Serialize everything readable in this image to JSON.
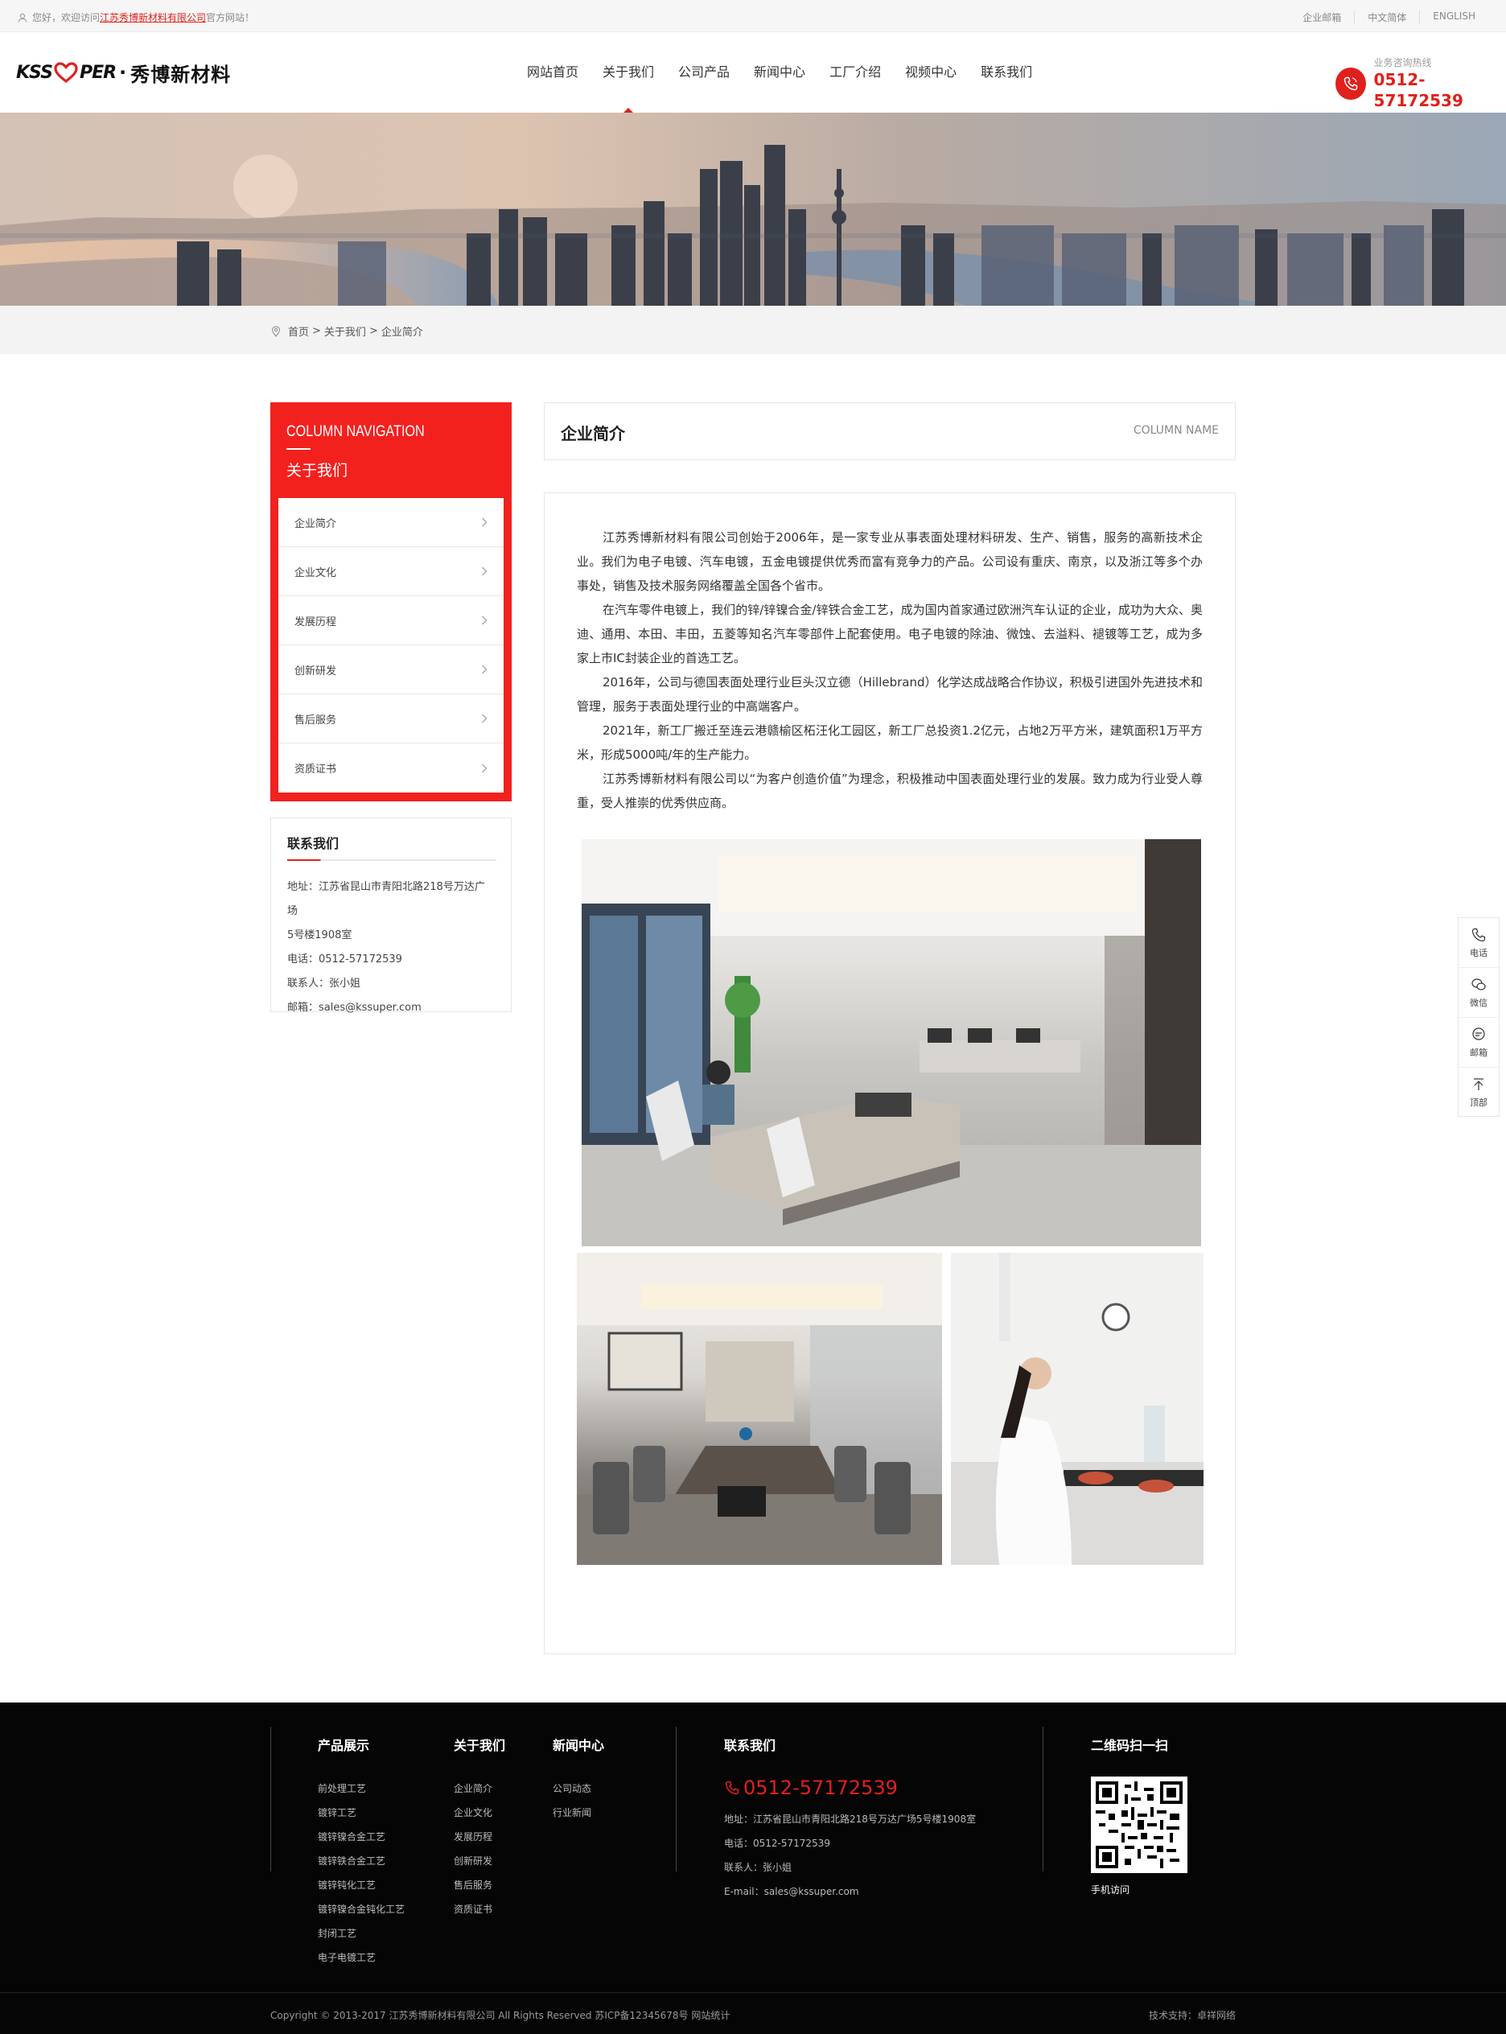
{
  "topbar": {
    "welcome_prefix": "您好，欢迎访问",
    "company_link": "江苏秀博新材料有限公司",
    "welcome_suffix": "官方网站！",
    "links": [
      "企业邮箱",
      "中文简体",
      "ENGLISH"
    ]
  },
  "header": {
    "logo_left": "KSS",
    "logo_right": "PER",
    "logo_dot": "·",
    "logo_cn": "秀博新材料",
    "nav": [
      "网站首页",
      "关于我们",
      "公司产品",
      "新闻中心",
      "工厂介绍",
      "视频中心",
      "联系我们"
    ],
    "hotline_label": "业务咨询热线",
    "hotline_number": "0512-57172539"
  },
  "breadcrumb": {
    "home": "首页",
    "sep": ">",
    "level1": "关于我们",
    "level2": "企业简介"
  },
  "sidebar": {
    "title_en": "COLUMN NAVIGATION",
    "title_cn": "关于我们",
    "items": [
      "企业简介",
      "企业文化",
      "发展历程",
      "创新研发",
      "售后服务",
      "资质证书"
    ]
  },
  "contact": {
    "title": "联系我们",
    "lines": [
      "地址：江苏省昆山市青阳北路218号万达广场",
      "5号楼1908室",
      "电话：0512-57172539",
      "联系人：张小姐",
      "邮箱：sales@kssuper.com"
    ]
  },
  "main": {
    "title": "企业简介",
    "column_name": "COLUMN NAME",
    "paragraphs": [
      "江苏秀博新材料有限公司创始于2006年，是一家专业从事表面处理材料研发、生产、销售，服务的高新技术企业。我们为电子电镀、汽车电镀，五金电镀提供优秀而富有竞争力的产品。公司设有重庆、南京，以及浙江等多个办事处，销售及技术服务网络覆盖全国各个省市。",
      "在汽车零件电镀上，我们的锌/锌镍合金/锌铁合金工艺，成为国内首家通过欧洲汽车认证的企业，成功为大众、奥迪、通用、本田、丰田，五菱等知名汽车零部件上配套使用。电子电镀的除油、微蚀、去溢料、褪镀等工艺，成为多家上市IC封装企业的首选工艺。",
      "2016年，公司与德国表面处理行业巨头汉立德（Hillebrand）化学达成战略合作协议，积极引进国外先进技术和管理，服务于表面处理行业的中高端客户。",
      "2021年，新工厂搬迁至连云港赣榆区柘汪化工园区，新工厂总投资1.2亿元，占地2万平方米，建筑面积1万平方米，形成5000吨/年的生产能力。",
      "江苏秀博新材料有限公司以“为客户创造价值”为理念，积极推动中国表面处理行业的发展。致力成为行业受人尊重，受人推崇的优秀供应商。"
    ]
  },
  "float": [
    "电话",
    "微信",
    "邮箱",
    "顶部"
  ],
  "footer": {
    "products_title": "产品展示",
    "products": [
      "前处理工艺",
      "镀锌工艺",
      "镀锌镍合金工艺",
      "镀锌铁合金工艺",
      "镀锌钝化工艺",
      "镀锌镍合金钝化工艺",
      "封闭工艺",
      "电子电镀工艺"
    ],
    "about_title": "关于我们",
    "about": [
      "企业简介",
      "企业文化",
      "发展历程",
      "创新研发",
      "售后服务",
      "资质证书"
    ],
    "news_title": "新闻中心",
    "news": [
      "公司动态",
      "行业新闻"
    ],
    "contact_title": "联系我们",
    "phone": "0512-57172539",
    "contact_lines": [
      "地址：江苏省昆山市青阳北路218号万达广场5号楼1908室",
      "电话：0512-57172539",
      "联系人：张小姐",
      "E-mail：sales@kssuper.com"
    ],
    "qr_title": "二维码扫一扫",
    "qr_caption": "手机访问",
    "copyright": "Copyright © 2013-2017 江苏秀博新材料有限公司 All Rights Reserved 苏ICP备12345678号 网站统计",
    "tech": "技术支持：卓祥网络"
  },
  "colors": {
    "brand_red": "#e0201d",
    "footer_bg": "#050505"
  }
}
